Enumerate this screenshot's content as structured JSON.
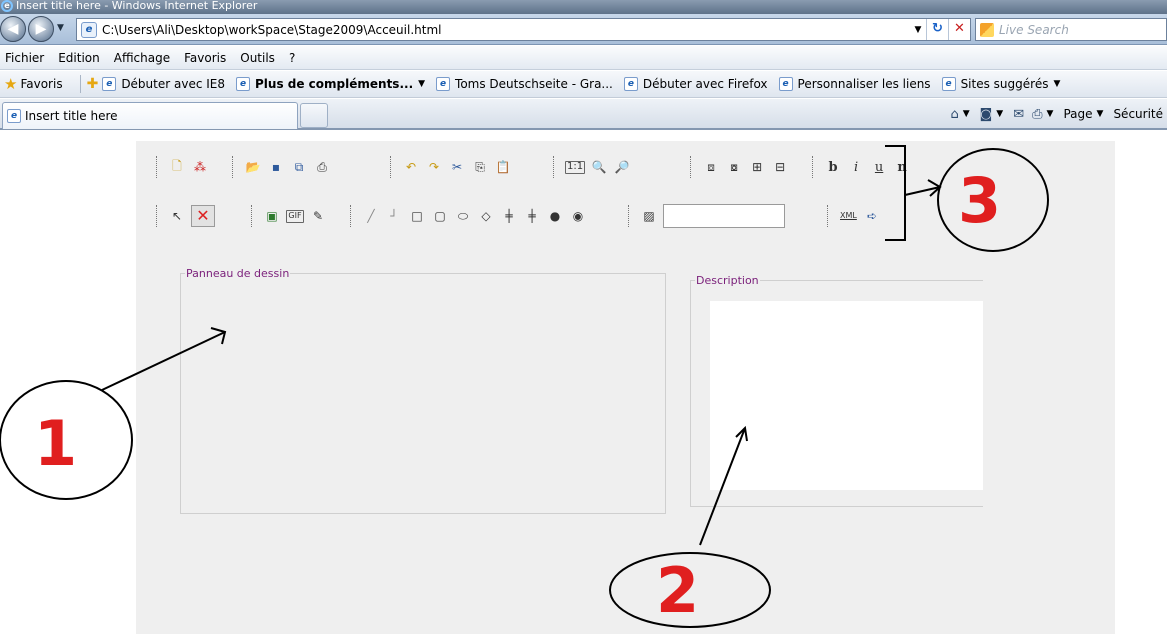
{
  "window": {
    "title": "Insert title here - Windows Internet Explorer"
  },
  "navigation": {
    "address": "C:\\Users\\Ali\\Desktop\\workSpace\\Stage2009\\Acceuil.html",
    "search_placeholder": "Live Search"
  },
  "menu": {
    "items": [
      "Fichier",
      "Edition",
      "Affichage",
      "Favoris",
      "Outils",
      "?"
    ]
  },
  "favorites": {
    "label": "Favoris",
    "items": [
      {
        "label": "Débuter avec IE8"
      },
      {
        "label": "Plus de compléments..."
      },
      {
        "label": "Toms Deutschseite - Gra..."
      },
      {
        "label": "Débuter avec Firefox"
      },
      {
        "label": "Personnaliser les liens"
      },
      {
        "label": "Sites suggérés"
      }
    ]
  },
  "tabs": {
    "active": "Insert title here"
  },
  "command_bar": {
    "page_label": "Page",
    "security_label": "Sécurité"
  },
  "toolbar": {
    "zoom_actual_label": "1:1",
    "bold_label": "b",
    "italic_label": "i",
    "underline_label": "u",
    "normal_label": "n",
    "gif_label": "GIF",
    "xml_label": "XML"
  },
  "panels": {
    "drawing_legend": "Panneau de dessin",
    "description_legend": "Description"
  },
  "annotations": {
    "labels": [
      "1",
      "2",
      "3"
    ],
    "ink_color": "#e01f1f"
  },
  "icons": {
    "back": "back-arrow-icon",
    "forward": "forward-arrow-icon",
    "refresh": "refresh-icon",
    "stop": "stop-icon",
    "favorites": "star-icon",
    "home": "home-icon",
    "rss": "rss-feed-icon",
    "mail": "mail-icon",
    "print": "print-icon"
  }
}
